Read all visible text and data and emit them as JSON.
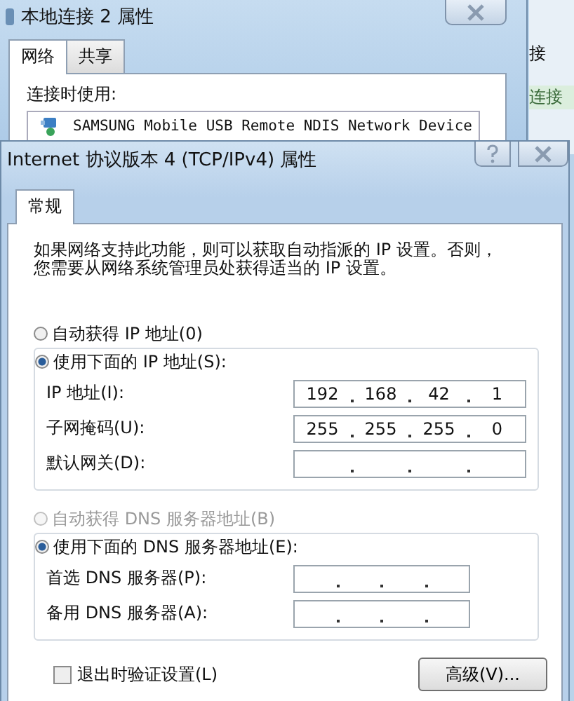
{
  "back_window": {
    "title": "本地连接 2 属性",
    "tabs": [
      {
        "label": "网络",
        "selected": true
      },
      {
        "label": "共享",
        "selected": false
      }
    ],
    "connect_label": "连接时使用:",
    "device": "SAMSUNG Mobile USB Remote NDIS Network Device"
  },
  "side_window": {
    "heading": "接",
    "label": "连接"
  },
  "dialog": {
    "title": "Internet 协议版本 4 (TCP/IPv4) 属性",
    "tabs": [
      {
        "label": "常规",
        "selected": true
      }
    ],
    "description": [
      "如果网络支持此功能，则可以获取自动指派的 IP 设置。否则，",
      "您需要从网络系统管理员处获得适当的 IP 设置。"
    ],
    "groups": [
      {
        "auto_option": {
          "label": "自动获得 IP 地址(0)",
          "selected": false,
          "disabled": false
        },
        "manual_option": {
          "label": "使用下面的 IP 地址(S):",
          "selected": true,
          "disabled": false
        },
        "fields": [
          {
            "label": "IP 地址(I):",
            "octets": [
              "192",
              "168",
              "42",
              "1"
            ]
          },
          {
            "label": "子网掩码(U):",
            "octets": [
              "255",
              "255",
              "255",
              "0"
            ]
          },
          {
            "label": "默认网关(D):"
          }
        ]
      },
      {
        "auto_option": {
          "label": "自动获得 DNS 服务器地址(B)",
          "selected": false,
          "disabled": true
        },
        "manual_option": {
          "label": "使用下面的 DNS 服务器地址(E):",
          "selected": true,
          "disabled": false
        },
        "fields": [
          {
            "label": "首选 DNS 服务器(P):"
          },
          {
            "label": "备用 DNS 服务器(A):"
          }
        ]
      }
    ],
    "validate_checkbox": {
      "label": "退出时验证设置(L)",
      "checked": false
    },
    "advanced_button": "高级(V)..."
  }
}
